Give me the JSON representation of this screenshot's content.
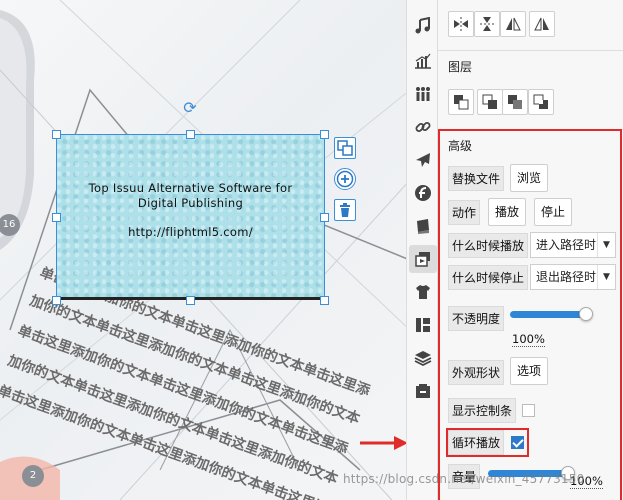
{
  "canvas": {
    "page_badges": [
      "16",
      "2"
    ],
    "object": {
      "title_line1": "Top Issuu Alternative Software for",
      "title_line2": "Digital Publishing",
      "url": "http://fliphtml5.com/"
    },
    "rotated_text_lines": [
      "单击这里添加你的文本单击这里添加你的文本单击这里添",
      "加你的文本单击这里添加你的文本单击这里添加你的文本",
      "单击这里添加你的文本单击这里添加你的文本单击这里添",
      "加你的文本单击这里添加你的文本单击这里添加你的文本",
      "单击这里添加你的文本单击这里添加你的文本单击这里添"
    ]
  },
  "sidebar": {
    "items": [
      "music-icon",
      "chart-icon",
      "people-icon",
      "link-icon",
      "airplane-icon",
      "flash-icon",
      "book-icon",
      "media-icon",
      "shirt-icon",
      "layout-icon",
      "layers-icon",
      "archive-icon"
    ],
    "active_index": 7
  },
  "panel": {
    "layer_title": "图层",
    "advanced_title": "高级",
    "replace_file_label": "替换文件",
    "browse_label": "浏览",
    "action_label": "动作",
    "play_label": "播放",
    "stop_label": "停止",
    "when_play_label": "什么时候播放",
    "when_play_value": "进入路径时",
    "when_stop_label": "什么时候停止",
    "when_stop_value": "退出路径时",
    "opacity_label": "不透明度",
    "opacity_value": "100%",
    "opacity_fraction": 1.0,
    "appearance_label": "外观形状",
    "options_label": "选项",
    "show_controls_label": "显示控制条",
    "show_controls_checked": false,
    "loop_label": "循环播放",
    "loop_checked": true,
    "volume_label": "音量",
    "volume_value": "100%",
    "volume_fraction": 1.0
  },
  "watermark": "https://blog.csdn.net/weixin_45773150",
  "colors": {
    "accent": "#2f86d6",
    "highlight_red": "#e02b2b",
    "object_fill": "#aee0ea"
  }
}
